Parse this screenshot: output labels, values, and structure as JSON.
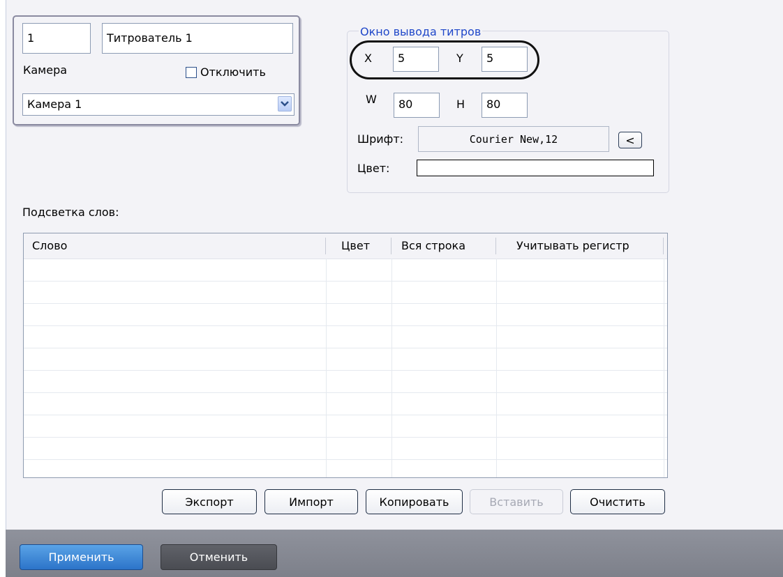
{
  "camera_section": {
    "id_value": "1",
    "name_value": "Титрователь 1",
    "camera_label": "Камера",
    "disable_label": "Отключить",
    "disable_checked": false,
    "camera_selected": "Камера 1"
  },
  "output_window": {
    "title": "Окно вывода титров",
    "x_label": "X",
    "x_value": "5",
    "y_label": "Y",
    "y_value": "5",
    "w_label": "W",
    "w_value": "80",
    "h_label": "H",
    "h_value": "80",
    "font_label": "Шрифт:",
    "font_value": "Courier New,12",
    "font_button_symbol": "<",
    "color_label": "Цвет:",
    "color_value": "#ffffff"
  },
  "highlight_section": {
    "label": "Подсветка слов:",
    "columns": [
      "Слово",
      "Цвет",
      "Вся строка",
      "Учитывать регистр"
    ],
    "rows": []
  },
  "actions": {
    "export": "Экспорт",
    "import": "Импорт",
    "copy": "Копировать",
    "paste": "Вставить",
    "clear": "Очистить"
  },
  "footer": {
    "apply": "Применить",
    "cancel": "Отменить"
  },
  "colors": {
    "accent_blue": "#2c74c9",
    "group_title": "#1f47c9",
    "footer_bar": "#868993"
  }
}
